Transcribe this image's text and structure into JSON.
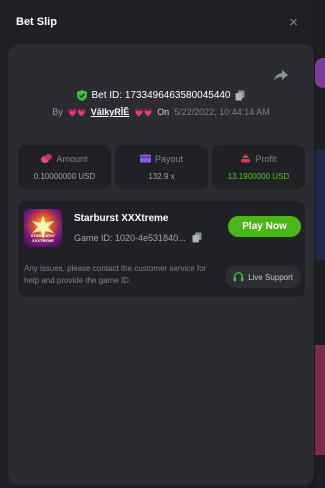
{
  "modal": {
    "title": "Bet Slip",
    "close_glyph": "×",
    "icons": {
      "close": "close-icon",
      "share": "share-icon",
      "verified": "shield-check-icon",
      "copy": "copy-icon"
    }
  },
  "bet": {
    "id_label": "Bet ID: 1733496463580045440",
    "by_label": "By",
    "user_hearts_left": "💗💗",
    "username": "VālkyRĪĒ",
    "user_hearts_right": "💗💗",
    "on_label": "On",
    "datetime": "5/22/2022, 10:44:14 AM"
  },
  "stats": {
    "amount": {
      "label": "Amount",
      "value": "0.10000000 USD"
    },
    "payout": {
      "label": "Payout",
      "value": "132.9 x"
    },
    "profit": {
      "label": "Profit",
      "value": "13.1900000 USD"
    }
  },
  "game": {
    "name": "Starburst XXXtreme",
    "id_text": "Game ID: 1020-4e531840...",
    "thumb_text": "STARBURST XXXTREME",
    "play_label": "Play Now",
    "issue_text": "Any issues, please contact the customer service for help and provide the game ID.",
    "support_label": "Live Support"
  },
  "colors": {
    "accent_green": "#4cb619",
    "profit_green": "#4cc62d",
    "amount_pink": "#e54580",
    "payout_purple": "#8a5ae8",
    "profit_red": "#e5354e"
  }
}
